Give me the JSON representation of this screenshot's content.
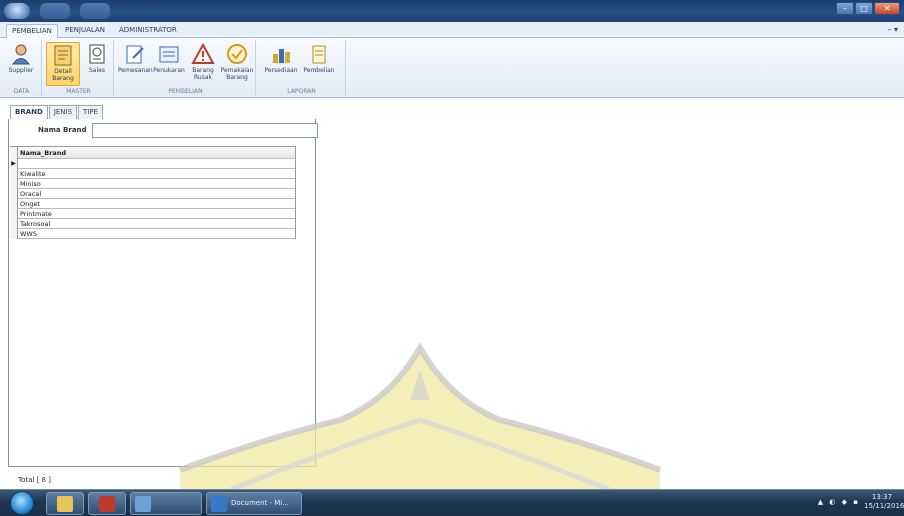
{
  "ribbon_tabs": [
    {
      "label": "PEMBELIAN",
      "active": true
    },
    {
      "label": "PENJUALAN",
      "active": false
    },
    {
      "label": "ADMINISTRATOR",
      "active": false
    }
  ],
  "ribbon_groups": [
    {
      "label": "DATA",
      "buttons": [
        {
          "label": "Supplier",
          "icon": "supplier-icon"
        }
      ]
    },
    {
      "label": "MASTER",
      "buttons": [
        {
          "label": "Detail Barang",
          "icon": "detail-barang-icon",
          "selected": true
        },
        {
          "label": "Sales",
          "icon": "sales-icon"
        }
      ]
    },
    {
      "label": "PEMBELIAN",
      "buttons": [
        {
          "label": "Pemesanan",
          "icon": "order-icon"
        },
        {
          "label": "Penukaran",
          "icon": "exchange-icon"
        },
        {
          "label": "Barang Rusak",
          "icon": "warning-icon"
        },
        {
          "label": "Pemakaian Barang",
          "icon": "check-icon"
        }
      ]
    },
    {
      "label": "LAPORAN",
      "buttons": [
        {
          "label": "Persediaan",
          "icon": "stock-report-icon"
        },
        {
          "label": "Pembelian",
          "icon": "purchase-report-icon"
        }
      ]
    }
  ],
  "doc_tabs": [
    {
      "label": "BRAND",
      "active": true
    },
    {
      "label": "JENIS",
      "active": false
    },
    {
      "label": "TIPE",
      "active": false
    }
  ],
  "form": {
    "field_label": "Nama Brand",
    "field_value": ""
  },
  "grid": {
    "column": "Nama_Brand",
    "rows": [
      "",
      "Kiwalite",
      "Miniso",
      "Oracal",
      "Onget",
      "Printmate",
      "Takrosoal",
      "WWS"
    ]
  },
  "record_nav": "Total [ 8 ]",
  "taskbar": {
    "window_label": "Document - Mi..."
  },
  "clock": {
    "time": "13:37",
    "date": "15/11/2016"
  },
  "colors": {
    "titlebar": "#274f86",
    "ribbon": "#e2ebf6",
    "selected_button": "#ffd46a",
    "watermark": "#f3e8a0"
  }
}
